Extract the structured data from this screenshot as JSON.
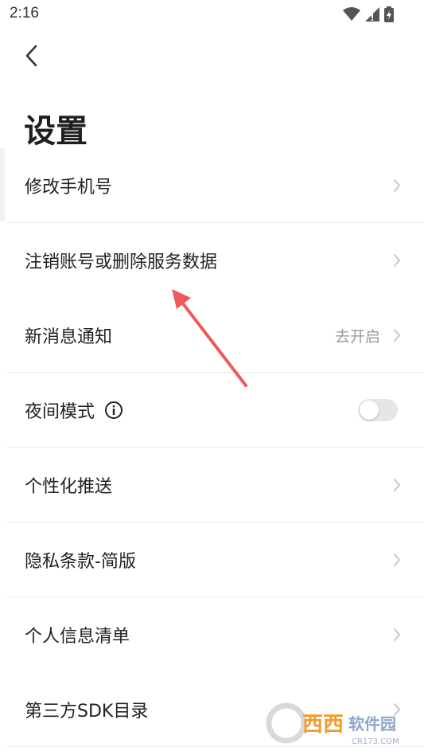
{
  "status_bar": {
    "time": "2:16"
  },
  "header": {
    "title": "设置"
  },
  "settings": [
    {
      "label": "修改手机号"
    },
    {
      "label": "注销账号或删除服务数据"
    },
    {
      "label": "新消息通知",
      "value": "去开启"
    },
    {
      "label": "夜间模式",
      "toggle_on": false
    },
    {
      "label": "个性化推送"
    },
    {
      "label": "隐私条款-简版"
    },
    {
      "label": "个人信息清单"
    },
    {
      "label": "第三方SDK目录"
    }
  ],
  "colors": {
    "arrow": "#ee5a5a",
    "chevron": "#c8c8c8",
    "toggle_off": "#e6e6e6"
  },
  "watermark": {
    "brand": "西西",
    "text": "软件园",
    "domain": "CR173.COM"
  }
}
